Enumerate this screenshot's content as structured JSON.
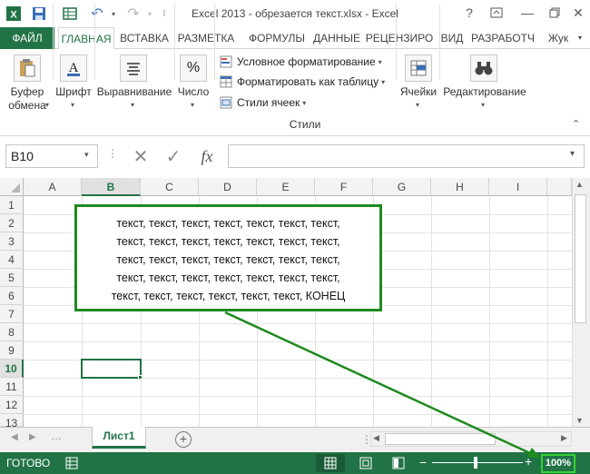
{
  "window": {
    "title": "Excel 2013 - обрезается текст.xlsx - Excel",
    "user": "Жук",
    "help": "?"
  },
  "tabs": [
    "ФАЙЛ",
    "ГЛАВНАЯ",
    "ВСТАВКА",
    "РАЗМЕТКА",
    "ФОРМУЛЫ",
    "ДАННЫЕ",
    "РЕЦЕНЗИРО",
    "ВИД",
    "РАЗРАБОТЧ"
  ],
  "ribbon": {
    "clipboard_line1": "Буфер",
    "clipboard_line2": "обмена",
    "font": "Шрифт",
    "alignment": "Выравнивание",
    "number": "Число",
    "conditional_formatting": "Условное форматирование",
    "format_as_table": "Форматировать как таблицу",
    "cell_styles": "Стили ячеек",
    "styles_group": "Стили",
    "cells": "Ячейки",
    "editing": "Редактирование"
  },
  "formula_bar": {
    "name_box": "B10",
    "fx": "fx",
    "formula": ""
  },
  "grid": {
    "columns": [
      "A",
      "B",
      "C",
      "D",
      "E",
      "F",
      "G",
      "H",
      "I"
    ],
    "rows": [
      "1",
      "2",
      "3",
      "4",
      "5",
      "6",
      "7",
      "8",
      "9",
      "10",
      "11",
      "12",
      "13"
    ],
    "selected_column": "B",
    "selected_row": "10"
  },
  "textbox": {
    "lines": [
      "текст, текст, текст, текст, текст, текст, текст,",
      "текст, текст, текст, текст, текст, текст, текст,",
      "текст, текст, текст, текст, текст, текст, текст,",
      "текст, текст, текст, текст, текст, текст, текст,",
      "текст, текст, текст, текст, текст, текст, КОНЕЦ"
    ]
  },
  "sheets": {
    "active": "Лист1"
  },
  "status": {
    "ready": "ГОТОВО",
    "zoom": "100%"
  },
  "colors": {
    "accent": "#217346",
    "annotation": "#1f8a1f"
  }
}
